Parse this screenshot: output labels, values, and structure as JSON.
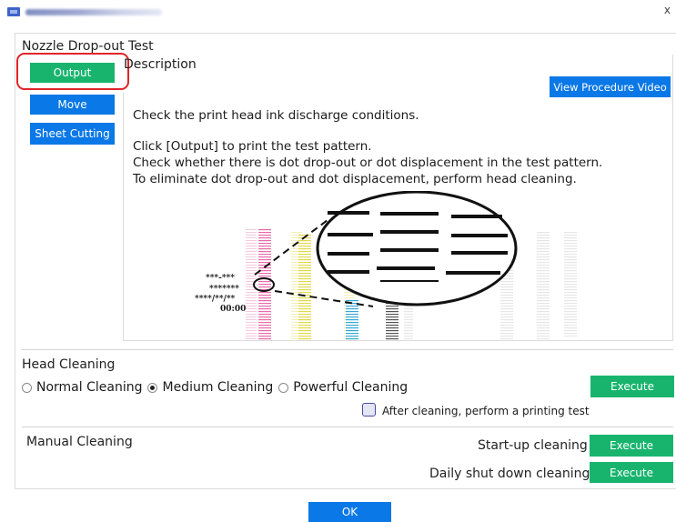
{
  "window": {
    "title_icon": "app-icon",
    "close_label": "x"
  },
  "nozzle_test": {
    "title": "Nozzle Drop-out Test",
    "output_label": "Output",
    "move_label": "Move",
    "sheet_cutting_label": "Sheet Cutting"
  },
  "description": {
    "heading": "Description",
    "video_label": "View Procedure Video",
    "line1": "Check the print head ink discharge conditions.",
    "line2": "Click [Output] to print the test pattern.",
    "line3": "Check whether there is dot drop-out or dot displacement in the test pattern.",
    "line4": "To eliminate dot drop-out and dot displacement, perform head cleaning.",
    "pattern_labels": [
      "***-***",
      "*******",
      "****/**/**",
      "00:00"
    ]
  },
  "head_cleaning": {
    "title": "Head Cleaning",
    "options": [
      "Normal Cleaning",
      "Medium Cleaning",
      "Powerful Cleaning"
    ],
    "selected": "Medium Cleaning",
    "execute_label": "Execute",
    "print_test_label": "After cleaning, perform a printing test"
  },
  "manual_cleaning": {
    "title": "Manual Cleaning",
    "startup_label": "Start-up cleaning",
    "startup_execute": "Execute",
    "shutdown_label": "Daily shut down cleaning",
    "shutdown_execute": "Execute"
  },
  "footer": {
    "ok_label": "OK"
  },
  "colors": {
    "blue_button": "#0a78e6",
    "green_button": "#18b46e",
    "highlight": "#e0242a",
    "magenta": "#e86aa8",
    "yellow": "#e4d84a",
    "cyan": "#35a7d6",
    "black": "#222222"
  }
}
